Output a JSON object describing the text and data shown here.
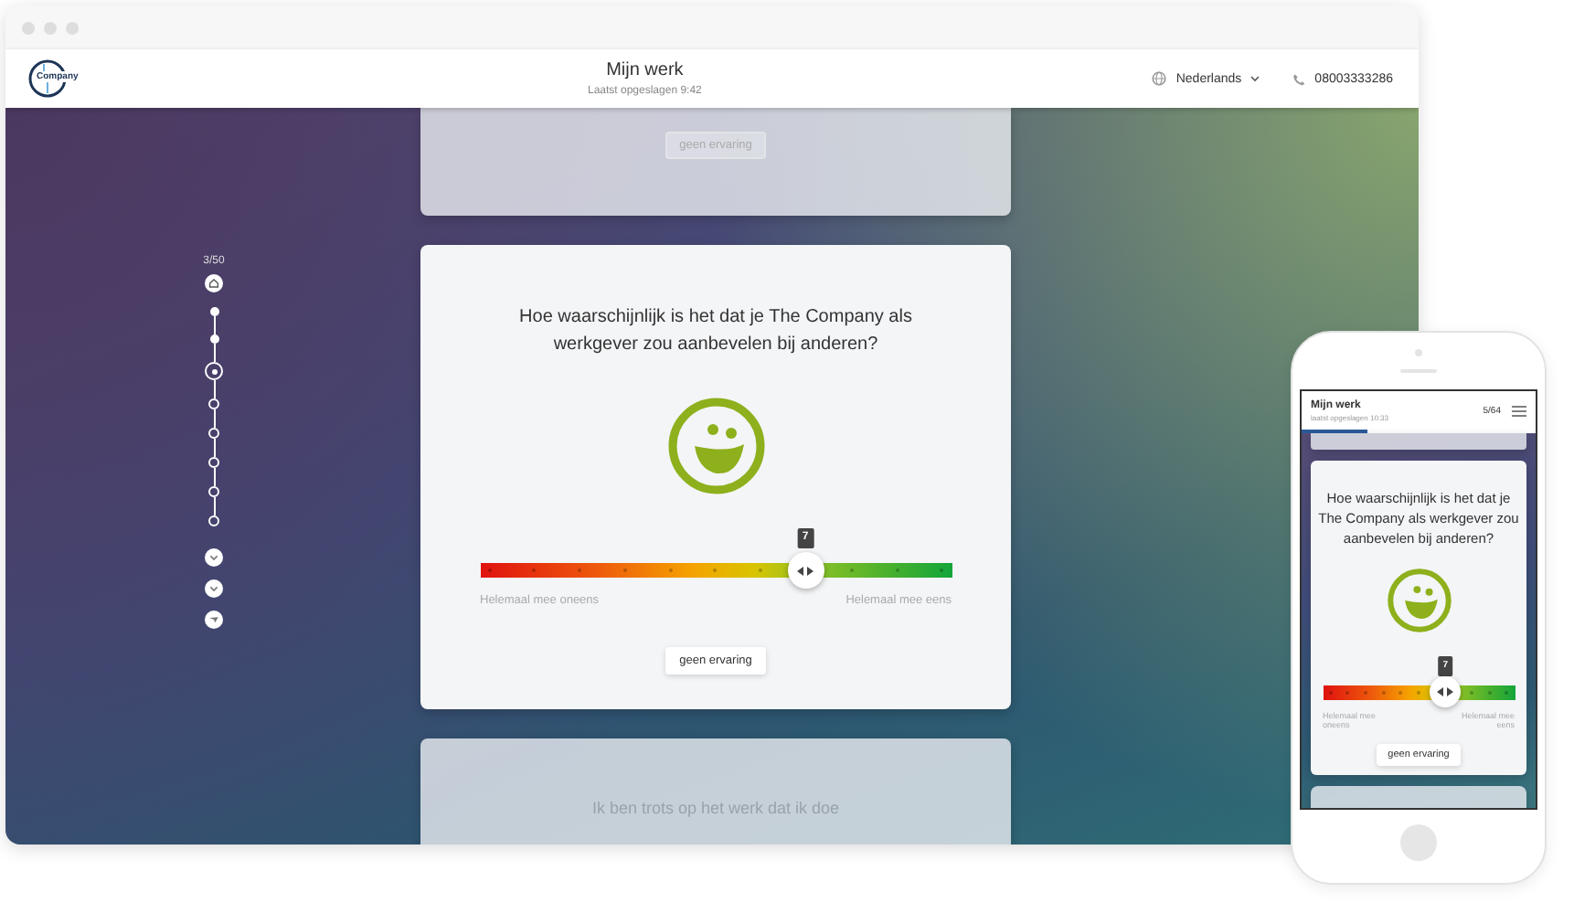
{
  "desktop": {
    "header": {
      "logo_text": "Company",
      "title": "Mijn werk",
      "saved": "Laatst opgeslagen 9:42",
      "language": "Nederlands",
      "phone": "08003333286"
    },
    "progress": {
      "counter": "3/50",
      "steps": [
        {
          "kind": "done"
        },
        {
          "kind": "done"
        },
        {
          "kind": "current"
        },
        {
          "kind": "todo"
        },
        {
          "kind": "todo"
        },
        {
          "kind": "todo"
        },
        {
          "kind": "todo"
        },
        {
          "kind": "todo"
        }
      ]
    },
    "cards": [
      {
        "kind": "faded-button",
        "button": "geen ervaring"
      },
      {
        "kind": "question",
        "question": "Hoe waarschijnlijk is het dat je The Company als werkgever zou aanbevelen bij anderen?",
        "slider": {
          "value": "7",
          "level": 0.69
        },
        "min_label": "Helemaal mee oneens",
        "max_label": "Helemaal mee eens",
        "button": "geen ervaring"
      },
      {
        "kind": "faded-text",
        "text": "Ik ben trots op het werk dat ik doe"
      }
    ]
  },
  "phone": {
    "header": {
      "title": "Mijn werk",
      "saved": "laatst opgeslagen 10:33",
      "counter": "5/64"
    },
    "progress": {
      "level": 0.28
    },
    "cards": [
      {
        "kind": "faded-empty"
      },
      {
        "kind": "question",
        "question": "Hoe waarschijnlijk is het dat je The Company als werkgever zou aanbevelen bij anderen?",
        "slider": {
          "value": "7",
          "level": 0.64
        },
        "min_label": "Helemaal mee oneens",
        "max_label": "Helemaal mee eens",
        "button": "geen ervaring"
      },
      {
        "kind": "faded-empty"
      }
    ]
  }
}
